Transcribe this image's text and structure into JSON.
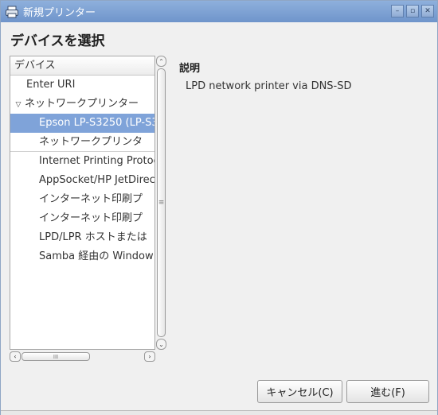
{
  "window": {
    "title": "新規プリンター",
    "icon": "printer-icon",
    "controls": [
      "minimize-icon",
      "maximize-icon",
      "close-icon"
    ],
    "control_glyphs": {
      "minimize": "–",
      "maximize": "▫",
      "close": "✕"
    }
  },
  "heading": "デバイスを選択",
  "device_list": {
    "header": "デバイス",
    "items": [
      {
        "label": "Enter URI",
        "level": 0
      },
      {
        "label": "ネットワークプリンター",
        "level": 0,
        "expander": "▽"
      },
      {
        "label": "Epson LP-S3250 (LP-S3",
        "level": 1,
        "selected": true
      },
      {
        "label": "ネットワークプリンタ",
        "level": 1
      },
      {
        "label": "Internet Printing Protoc",
        "level": 1
      },
      {
        "label": "AppSocket/HP JetDirec",
        "level": 1
      },
      {
        "label": "インターネット印刷プ",
        "level": 1
      },
      {
        "label": "インターネット印刷プ",
        "level": 1
      },
      {
        "label": "LPD/LPR ホストまたは",
        "level": 1
      },
      {
        "label": "Samba 経由の Window",
        "level": 1
      }
    ],
    "vscroll": {
      "up": "⌃",
      "down": "⌄",
      "grip": "≡"
    },
    "hscroll": {
      "left": "‹",
      "right": "›",
      "grip": "III"
    }
  },
  "description": {
    "title": "説明",
    "text": "LPD network printer via DNS-SD"
  },
  "buttons": {
    "cancel": "キャンセル(C)",
    "forward": "進む(F)"
  },
  "colors": {
    "titlebar": "#7fa3d9",
    "selection": "#7fa3d9"
  }
}
